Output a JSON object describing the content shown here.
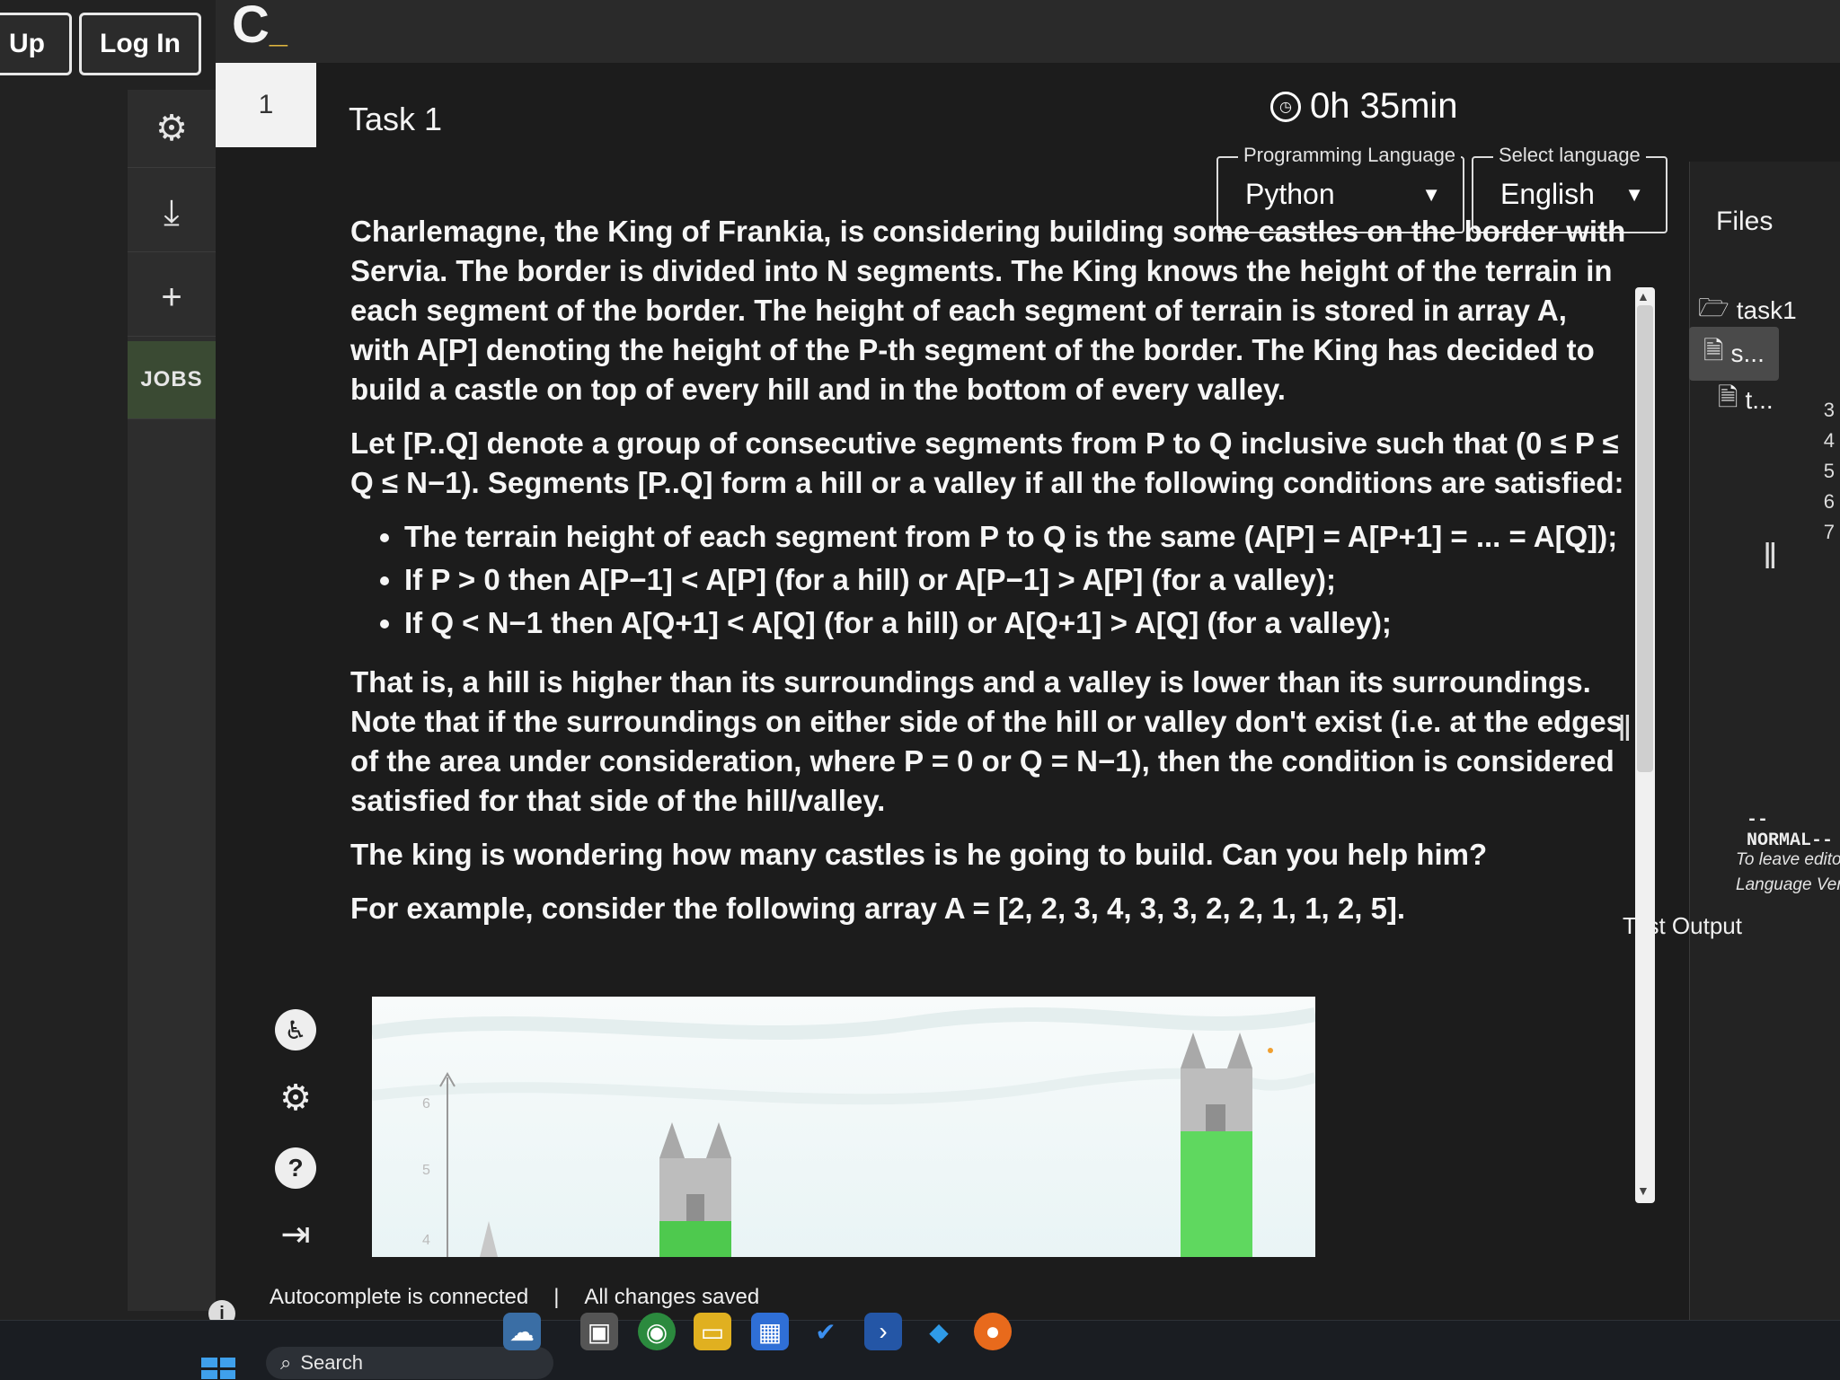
{
  "auth": {
    "signup_label": "Up",
    "login_label": "Log In"
  },
  "sidebar": {
    "jobs_label": "JOBS"
  },
  "task": {
    "number": "1",
    "title": "Task 1",
    "timer": "0h 35min"
  },
  "selectors": {
    "programming_language": {
      "legend": "Programming Language",
      "value": "Python"
    },
    "language": {
      "legend": "Select language",
      "value": "English"
    }
  },
  "description": {
    "p1": "Charlemagne, the King of Frankia, is considering building some castles on the border with Servia. The border is divided into N segments. The King knows the height of the terrain in each segment of the border. The height of each segment of terrain is stored in array A, with A[P] denoting the height of the P-th segment of the border. The King has decided to build a castle on top of every hill and in the bottom of every valley.",
    "p2": "Let [P..Q] denote a group of consecutive segments from P to Q inclusive such that (0 ≤ P ≤ Q ≤ N−1). Segments [P..Q] form a hill or a valley if all the following conditions are satisfied:",
    "bullets": [
      "The terrain height of each segment from P to Q is the same (A[P] = A[P+1] = ... = A[Q]);",
      "If P > 0 then A[P−1] < A[P] (for a hill) or A[P−1] > A[P] (for a valley);",
      "If Q < N−1 then A[Q+1] < A[Q] (for a hill) or A[Q+1] > A[Q] (for a valley);"
    ],
    "p3": "That is, a hill is higher than its surroundings and a valley is lower than its surroundings. Note that if the surroundings on either side of the hill or valley don't exist (i.e. at the edges of the area under consideration, where P = 0 or Q = N−1), then the condition is considered satisfied for that side of the hill/valley.",
    "p4": "The king is wondering how many castles is he going to build. Can you help him?",
    "p5": "For example, consider the following array A = [2, 2, 3, 4, 3, 3, 2, 2, 1, 1, 2, 5]."
  },
  "example_chart": {
    "y_ticks": [
      "6",
      "5",
      "4"
    ]
  },
  "files": {
    "title": "Files",
    "folder": "task1",
    "items": [
      "s...",
      "t..."
    ]
  },
  "editor": {
    "line_numbers": [
      "3",
      "4",
      "5",
      "6",
      "7"
    ],
    "mode": "--NORMAL--",
    "hint_line1": "To leave editor",
    "hint_line2": "Language Vers"
  },
  "test_output_label": "Test Output",
  "status": {
    "autocomplete": "Autocomplete is connected",
    "separator": "|",
    "saved": "All changes saved"
  },
  "taskbar": {
    "search_label": "Search"
  },
  "colors": {
    "background": "#1c1c1c",
    "accent_yellow": "#f5c542",
    "jobs_bg": "#3a4a33"
  }
}
